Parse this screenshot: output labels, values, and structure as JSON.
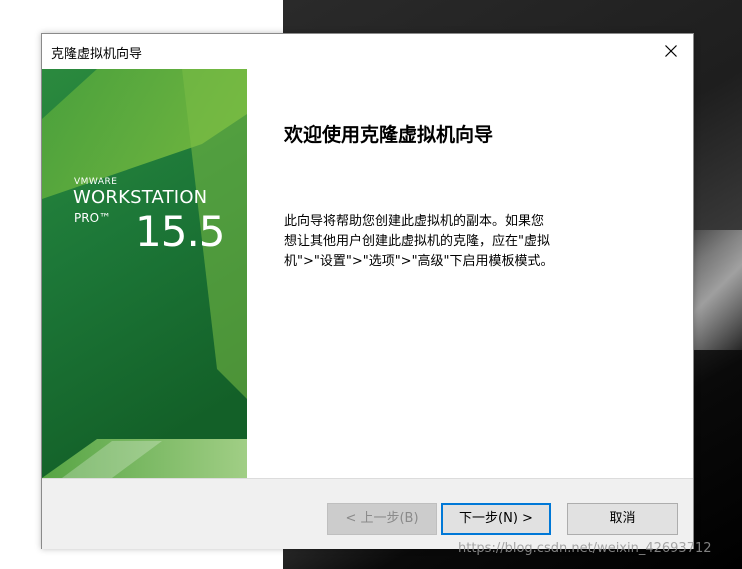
{
  "dialog": {
    "title": "克隆虚拟机向导",
    "close_icon": "close-icon"
  },
  "banner": {
    "brand_line1": "VMWARE",
    "brand_line2": "WORKSTATION",
    "brand_line3": "PRO™",
    "version": "15.5"
  },
  "content": {
    "heading": "欢迎使用克隆虚拟机向导",
    "description": "此向导将帮助您创建此虚拟机的副本。如果您想让其他用户创建此虚拟机的克隆，应在\"虚拟机\">\"设置\">\"选项\">\"高级\"下启用模板模式。"
  },
  "buttons": {
    "back": "< 上一步(B)",
    "next": "下一步(N) >",
    "cancel": "取消"
  },
  "watermark": "https://blog.csdn.net/weixin_42693712",
  "colors": {
    "accent": "#0078d7",
    "banner_dark_green": "#1a6e35",
    "banner_light_green": "#7bbf3f"
  }
}
